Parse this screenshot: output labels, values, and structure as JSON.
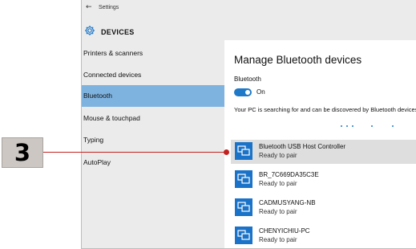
{
  "callout": {
    "number": "3"
  },
  "window": {
    "back_glyph": "←",
    "app_title": "Settings",
    "page_title": "DEVICES"
  },
  "sidebar": {
    "items": [
      {
        "label": "Printers & scanners",
        "selected": false
      },
      {
        "label": "Connected devices",
        "selected": false
      },
      {
        "label": "Bluetooth",
        "selected": true
      },
      {
        "label": "Mouse & touchpad",
        "selected": false
      },
      {
        "label": "Typing",
        "selected": false
      },
      {
        "label": "AutoPlay",
        "selected": false
      }
    ]
  },
  "content": {
    "section_title": "Manage Bluetooth devices",
    "bluetooth_label": "Bluetooth",
    "toggle_state": "On",
    "description": "Your PC is searching for and can be discovered by Bluetooth devices.",
    "devices": [
      {
        "name": "Bluetooth USB Host Controller",
        "status": "Ready to pair",
        "highlighted": true
      },
      {
        "name": "BR_7C669DA35C3E",
        "status": "Ready to pair",
        "highlighted": false
      },
      {
        "name": "CADMUSYANG-NB",
        "status": "Ready to pair",
        "highlighted": false
      },
      {
        "name": "CHENYICHIU-PC",
        "status": "Ready to pair",
        "highlighted": false
      }
    ]
  },
  "colors": {
    "accent": "#1f79c9",
    "selection": "#7eb3e0",
    "callout_line": "#c4201f",
    "callout_bg": "#ccc7c3"
  },
  "icons": {
    "back": "back-arrow-icon",
    "settings": "gear-icon",
    "device": "bluetooth-device-icon"
  }
}
